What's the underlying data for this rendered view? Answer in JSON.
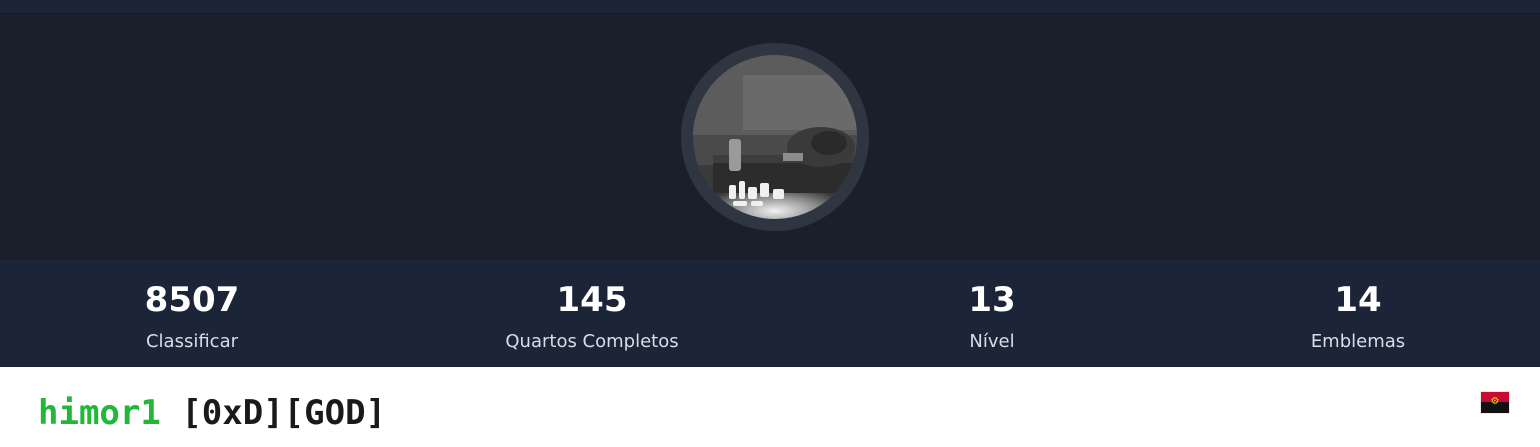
{
  "stats": [
    {
      "value": "8507",
      "label": "Classificar"
    },
    {
      "value": "145",
      "label": "Quartos Completos"
    },
    {
      "value": "13",
      "label": "Nível"
    },
    {
      "value": "14",
      "label": "Emblemas"
    }
  ],
  "profile": {
    "username": "himor1",
    "ranks": "[0xD][GOD]",
    "country_flag": "angola-flag-icon"
  },
  "colors": {
    "banner": "#1a1f2b",
    "stats_bar": "#1c2538",
    "username": "#21b83a"
  }
}
